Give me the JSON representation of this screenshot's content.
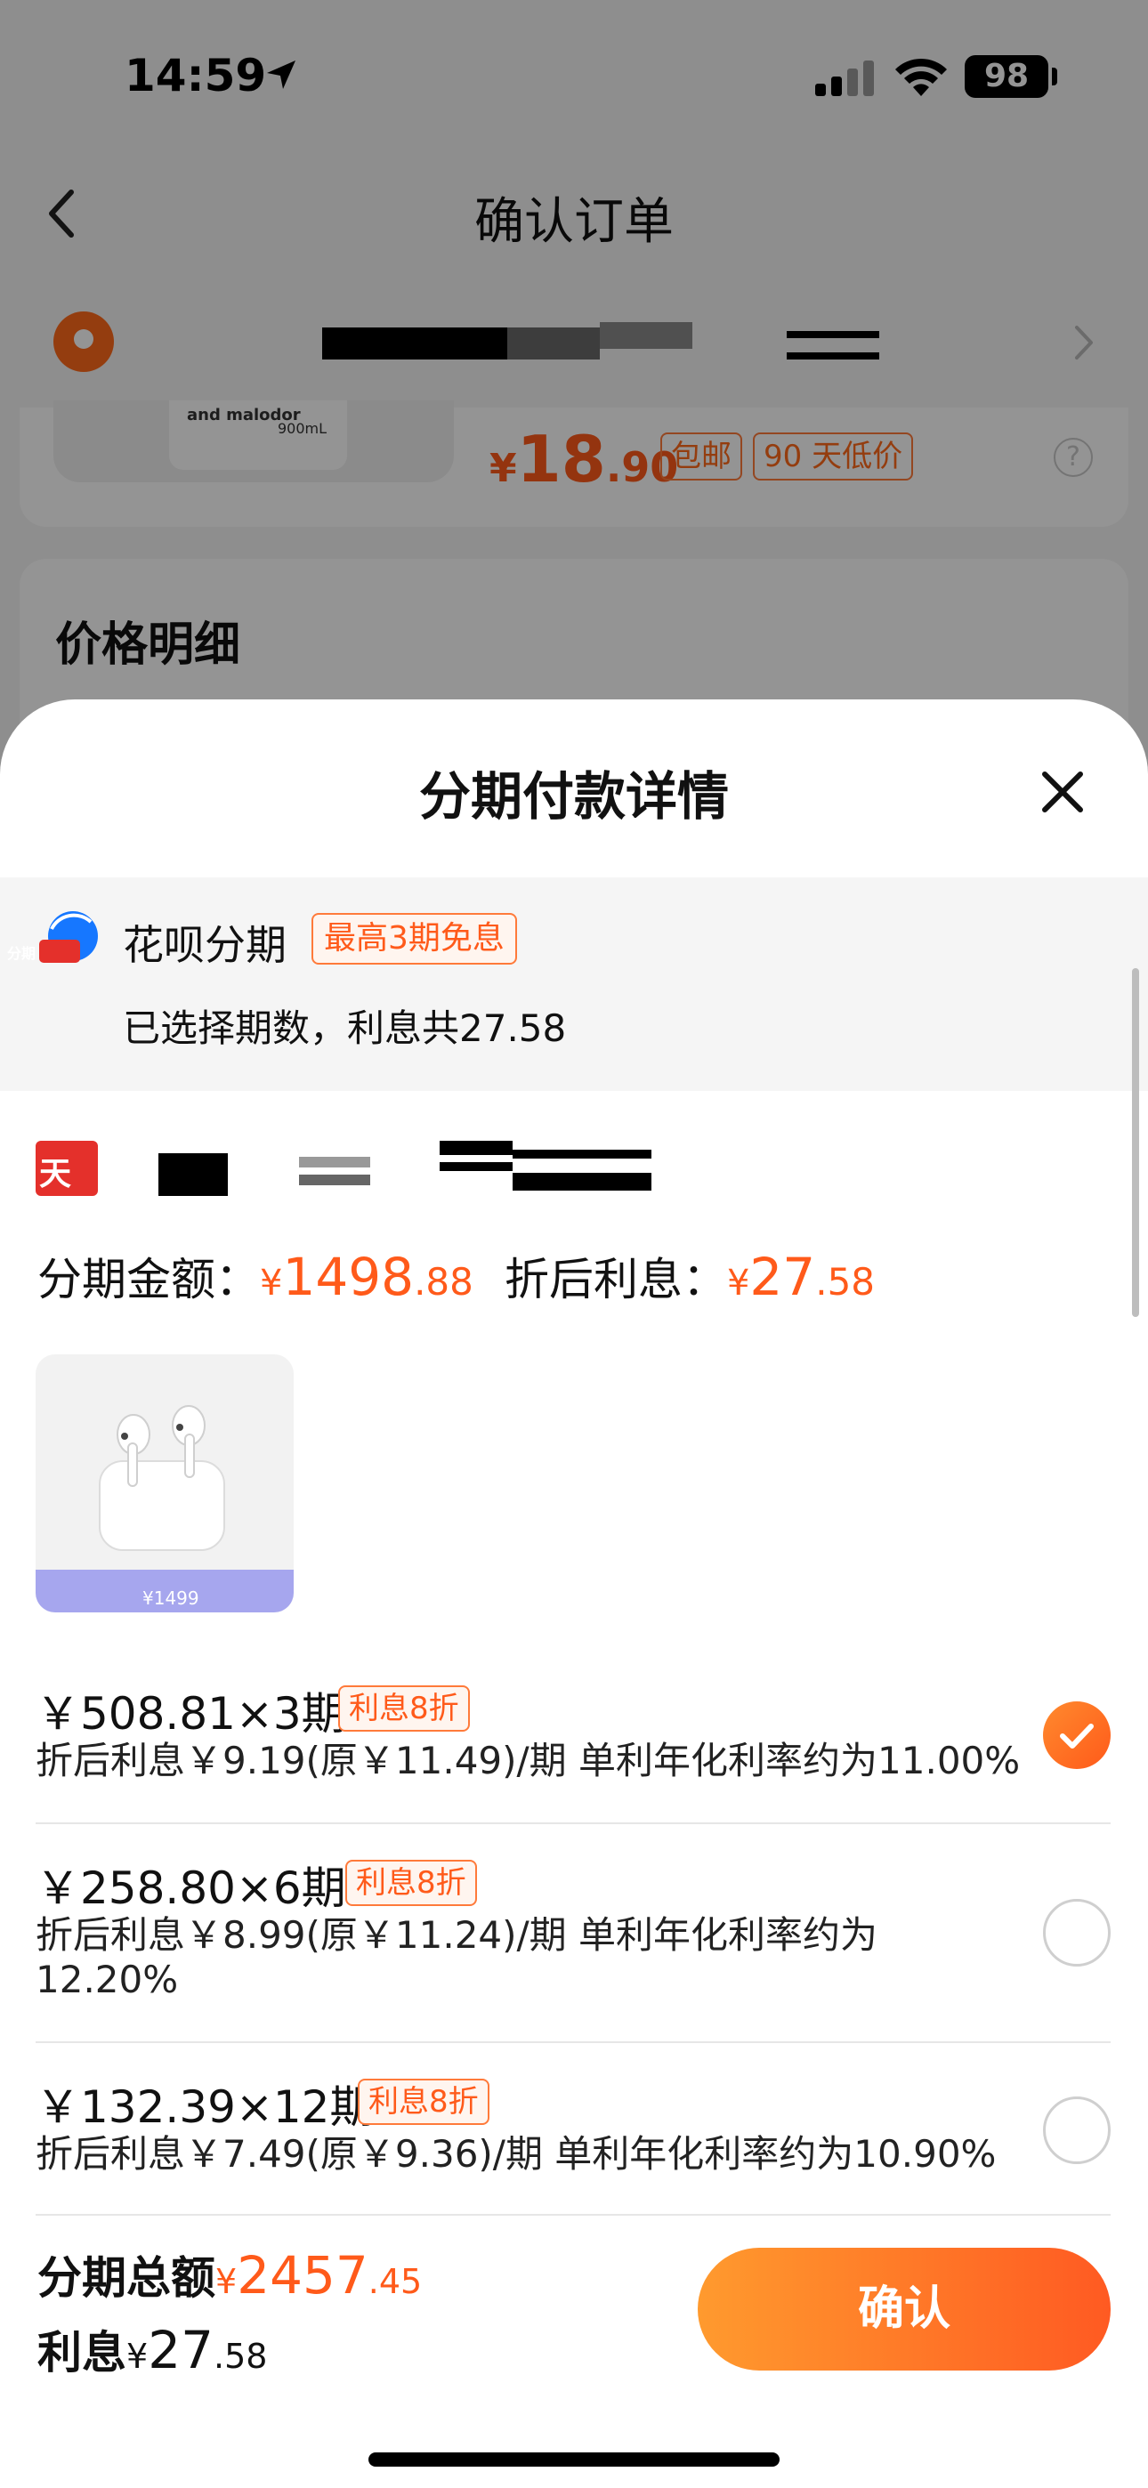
{
  "status": {
    "time": "14:59",
    "battery": "98"
  },
  "background_page": {
    "nav_title": "确认订单",
    "product_box_text1": "and malodor",
    "product_box_text2": "900mL",
    "price": {
      "currency": "¥",
      "integer": "18",
      "decimal": ".90"
    },
    "tags": [
      "包邮",
      "90 天低价"
    ],
    "help_icon": "?",
    "section_title": "价格明细"
  },
  "sheet": {
    "title": "分期付款详情",
    "huabei": {
      "name": "花呗分期",
      "promo": "最高3期免息",
      "logo_text": "分期",
      "desc": "已选择期数，利息共27.58"
    },
    "store_logo_text": "天猫",
    "amount": {
      "label": "分期金额：",
      "currency": "¥",
      "integer": "1498",
      "decimal": ".88",
      "interest_label": "折后利息：",
      "interest_currency": "¥",
      "interest_integer": "27",
      "interest_decimal": ".58"
    },
    "product_image": {
      "price_text": "¥1499"
    },
    "plans": [
      {
        "main": "￥508.81×3期",
        "tag": "利息8折",
        "desc": "折后利息￥9.19(原￥11.49)/期 单利年化利率约为11.00%",
        "selected": true
      },
      {
        "main": "￥258.80×6期",
        "tag": "利息8折",
        "desc": "折后利息￥8.99(原￥11.24)/期 单利年化利率约为 12.20%",
        "selected": false
      },
      {
        "main": "￥132.39×12期",
        "tag": "利息8折",
        "desc": "折后利息￥7.49(原￥9.36)/期 单利年化利率约为10.90%",
        "selected": false
      }
    ],
    "footer": {
      "total_label": "分期总额",
      "total_currency": "¥",
      "total_integer": "2457",
      "total_decimal": ".45",
      "interest_label": "利息",
      "interest_currency": "¥",
      "interest_integer": "27",
      "interest_decimal": ".58",
      "confirm_label": "确认"
    }
  },
  "colors": {
    "accent": "#ff5a1a",
    "button_gradient_start": "#ff9a2e",
    "button_gradient_end": "#ff5a22",
    "store_red": "#e4302b"
  }
}
